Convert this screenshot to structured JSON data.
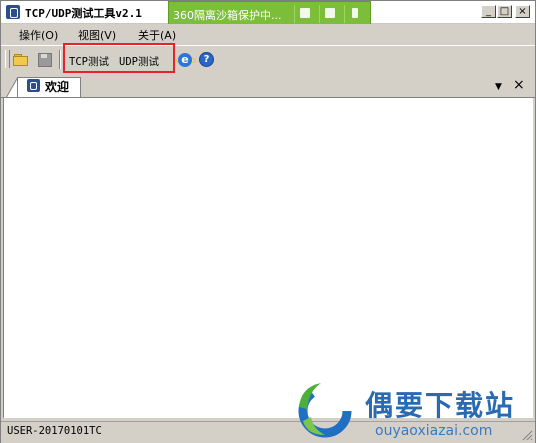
{
  "window": {
    "title": "TCP/UDP测试工具v2.1",
    "minimize": "_",
    "maximize": "□",
    "close": "×"
  },
  "sandbox": {
    "text": "360隔离沙箱保护中..."
  },
  "menu": {
    "items": [
      "操作(O)",
      "视图(V)",
      "关于(A)"
    ]
  },
  "toolbar": {
    "tcp_label": "TCP测试",
    "udp_label": "UDP测试",
    "highlight_color": "#e8222a"
  },
  "tabs": {
    "active_label": "欢迎",
    "dropdown": "▼",
    "close": "×"
  },
  "status": {
    "text": "USER-20170101TC"
  },
  "watermark": {
    "title": "偶要下载站",
    "url": "ouyaoxiazai.com"
  }
}
